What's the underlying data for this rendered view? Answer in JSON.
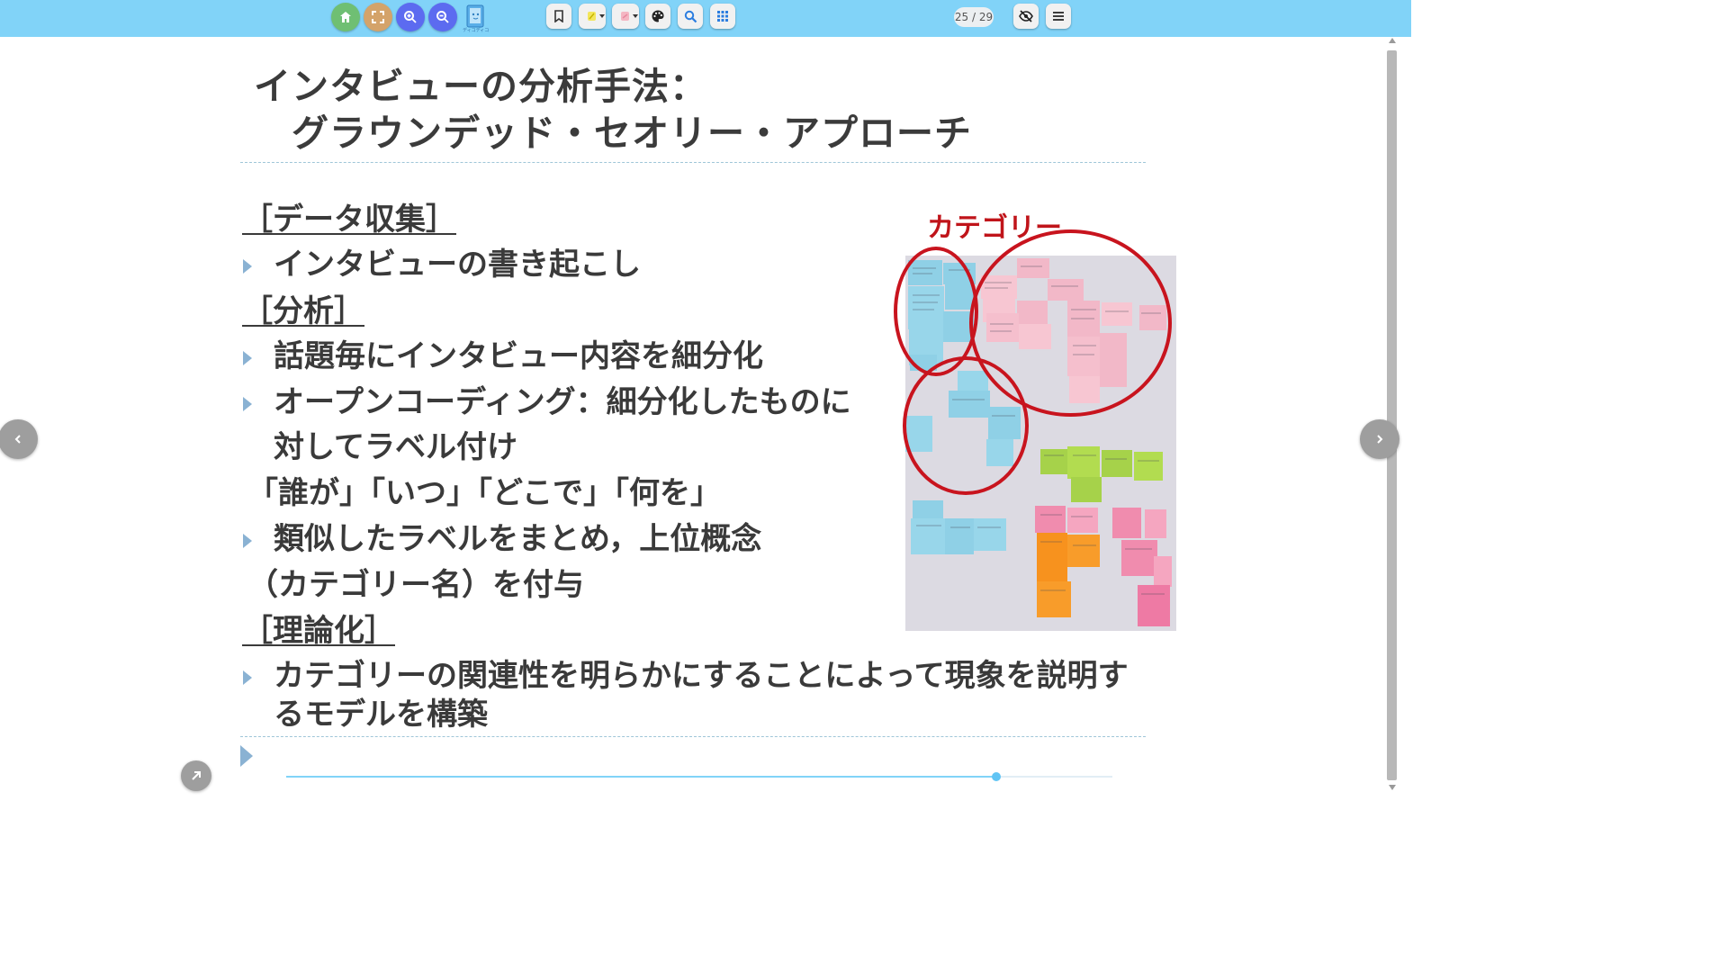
{
  "toolbar": {
    "buttons": [
      {
        "icon": "home-icon",
        "color": "#6fbf73"
      },
      {
        "icon": "fullscreen-icon",
        "color": "#d4a36a"
      },
      {
        "icon": "zoom-in-icon",
        "color": "#5c6bf0"
      },
      {
        "icon": "zoom-out-icon",
        "color": "#5c6bf0"
      }
    ],
    "logo_caption": "ディコディコ",
    "tools": [
      "bookmark-icon",
      "highlighter-icon",
      "eraser-icon",
      "palette-icon",
      "search-icon",
      "grid-icon"
    ],
    "page_counter": "25 / 29",
    "right_tools": [
      "eye-off-icon",
      "menu-icon"
    ]
  },
  "slide": {
    "title_line1": "インタビューの分析手法：",
    "title_line2": "グラウンデッド・セオリー・アプローチ",
    "section_data": "［データ収集］",
    "bullet_transcription": "インタビューの書き起こし",
    "section_analysis": "［分析］",
    "bullet_segment": "話題毎にインタビュー内容を細分化",
    "bullet_open_coding_1": "オープンコーディング：細分化したものに",
    "bullet_open_coding_2": "対してラベル付け",
    "quote_line": "「誰が」「いつ」「どこで」「何を」",
    "bullet_similar": "類似したラベルをまとめ，上位概念",
    "category_name_line": "（カテゴリー名）を付与",
    "section_theory": "［理論化］",
    "bullet_relation_1": "カテゴリーの関連性を明らかにすることによって現象を説明す",
    "bullet_relation_2": "るモデルを構築",
    "photo_annotation": "カテゴリー"
  },
  "progress": {
    "current_page": 25,
    "total_pages": 29,
    "fraction": 0.86
  },
  "colors": {
    "toolbar": "#81d3f8",
    "annotation_red": "#c0141a",
    "bullet": "#8ab2d3"
  }
}
